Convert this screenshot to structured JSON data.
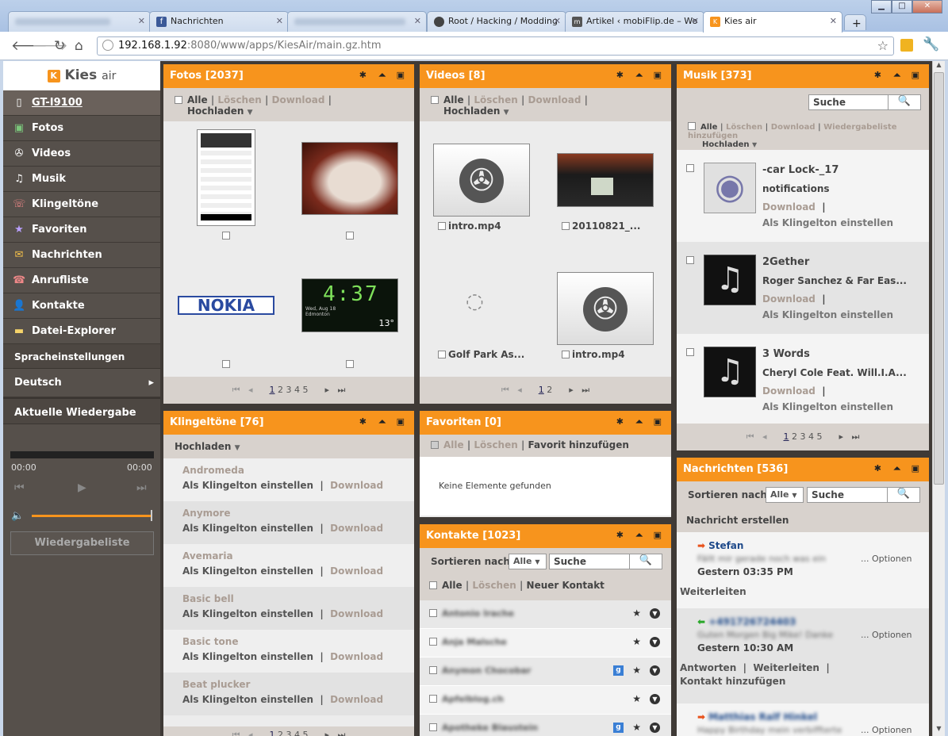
{
  "browser": {
    "tabs": [
      {
        "title": "",
        "blurred": true
      },
      {
        "title": "Nachrichten"
      },
      {
        "title": "",
        "blurred": true
      },
      {
        "title": "Root / Hacking / Modding"
      },
      {
        "title": "Artikel ‹ mobiFlip.de – Wo"
      },
      {
        "title": "Kies air",
        "active": true
      }
    ],
    "address_host": "192.168.1.92",
    "address_rest": ":8080/www/apps/KiesAir/main.gz.htm"
  },
  "logo": {
    "text": "Kies",
    "suffix": "air"
  },
  "sidebar": {
    "device": "GT-I9100",
    "items": [
      {
        "label": "Fotos",
        "icon": "photo-icon"
      },
      {
        "label": "Videos",
        "icon": "film-reel-icon"
      },
      {
        "label": "Musik",
        "icon": "music-note-icon"
      },
      {
        "label": "Klingeltöne",
        "icon": "phone-ring-icon"
      },
      {
        "label": "Favoriten",
        "icon": "star-icon"
      },
      {
        "label": "Nachrichten",
        "icon": "envelope-icon"
      },
      {
        "label": "Anrufliste",
        "icon": "call-log-icon"
      },
      {
        "label": "Kontakte",
        "icon": "person-icon"
      },
      {
        "label": "Datei-Explorer",
        "icon": "folder-icon"
      }
    ],
    "language_section": "Spracheinstellungen",
    "language": "Deutsch",
    "player_section": "Aktuelle Wiedergabe",
    "time_start": "00:00",
    "time_end": "00:00",
    "playlist_button": "Wiedergabeliste"
  },
  "fotos": {
    "title": "Fotos [2037]",
    "alle": "Alle",
    "loeschen": "Löschen",
    "download": "Download",
    "hochladen": "Hochladen",
    "nokia": "NOKIA",
    "clock": "4:37",
    "clock_date": "Wed, Aug 18",
    "clock_place": "Edmonton",
    "clock_temp": "13°",
    "pages": [
      "1",
      "2",
      "3",
      "4",
      "5"
    ]
  },
  "videos": {
    "title": "Videos [8]",
    "alle": "Alle",
    "loeschen": "Löschen",
    "download": "Download",
    "hochladen": "Hochladen",
    "items": [
      "intro.mp4",
      "20110821_...",
      "Golf Park As...",
      "intro.mp4"
    ],
    "pages": [
      "1",
      "2"
    ]
  },
  "musik": {
    "title": "Musik [373]",
    "search_placeholder": "Suche",
    "actions": {
      "alle": "Alle",
      "loeschen": "Löschen",
      "download": "Download",
      "playlist": "Wiedergabeliste hinzufügen",
      "hochladen": "Hochladen"
    },
    "items": [
      {
        "title": "-car Lock-_17",
        "artist": "notifications"
      },
      {
        "title": "2Gether",
        "artist": "Roger Sanchez & Far Eas..."
      },
      {
        "title": "3 Words",
        "artist": "Cheryl Cole Feat. Will.I.A..."
      }
    ],
    "download": "Download",
    "ringtone": "Als Klingelton einstellen",
    "pages": [
      "1",
      "2",
      "3",
      "4",
      "5"
    ]
  },
  "klingeltoene": {
    "title": "Klingeltöne [76]",
    "hochladen": "Hochladen",
    "items": [
      "Andromeda",
      "Anymore",
      "Avemaria",
      "Basic bell",
      "Basic tone",
      "Beat plucker"
    ],
    "set": "Als Klingelton einstellen",
    "download": "Download",
    "pages": [
      "1",
      "2",
      "3",
      "4",
      "5"
    ]
  },
  "favoriten": {
    "title": "Favoriten [0]",
    "alle": "Alle",
    "loeschen": "Löschen",
    "add": "Favorit hinzufügen",
    "empty": "Keine Elemente gefunden"
  },
  "kontakte": {
    "title": "Kontakte [1023]",
    "sort_label": "Sortieren nach",
    "sort_value": "Alle",
    "search_placeholder": "Suche",
    "alle": "Alle",
    "loeschen": "Löschen",
    "new": "Neuer Kontakt",
    "rows": [
      {
        "name": "Antonio Irache",
        "google": false
      },
      {
        "name": "Anja Malsche",
        "google": false
      },
      {
        "name": "Anymon Chocobar",
        "google": true
      },
      {
        "name": "Apfelblog.ch",
        "google": false
      },
      {
        "name": "Apotheke Blaustein",
        "google": true
      }
    ]
  },
  "nachrichten": {
    "title": "Nachrichten [536]",
    "sort_label": "Sortieren nach",
    "sort_value": "Alle",
    "search_placeholder": "Suche",
    "create": "Nachricht erstellen",
    "options": "... Optionen",
    "messages": [
      {
        "from": "Stefan",
        "preview": "Fällt mir gerade noch was ein",
        "time": "Gestern 03:35 PM",
        "actions": [
          "Weiterleiten"
        ],
        "arrow": "out",
        "from_blurred": false
      },
      {
        "from": "+491726724403",
        "preview": "Guten Morgen Big Mike! Danke",
        "time": "Gestern 10:30 AM",
        "actions": [
          "Antworten",
          "Weiterleiten",
          "Kontakt hinzufügen"
        ],
        "arrow": "in",
        "from_blurred": true
      },
      {
        "from": "Matthias Ralf Hinkel",
        "preview": "Happy Birthday mein verbiffterte",
        "time": "",
        "actions": [],
        "arrow": "out",
        "from_blurred": true
      }
    ]
  }
}
